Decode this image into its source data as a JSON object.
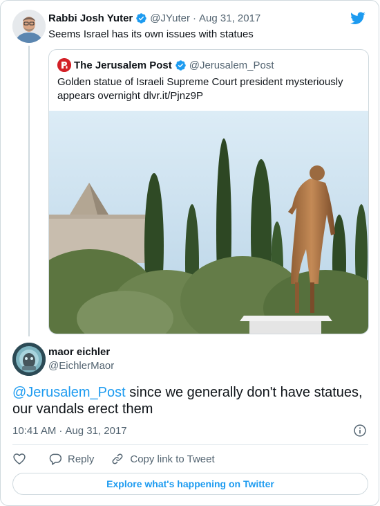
{
  "colors": {
    "accent": "#1d9bf0",
    "text": "#0f1419",
    "secondary": "#536471",
    "border": "#cfd9de",
    "jpost_brand": "#d32027"
  },
  "parent_tweet": {
    "author_name": "Rabbi Josh Yuter",
    "handle": "@JYuter",
    "separator": "·",
    "date": "Aug 31, 2017",
    "text": "Seems Israel has its own issues with statues",
    "verified": true,
    "avatar_icon": "user-avatar"
  },
  "quoted_tweet": {
    "author_name": "The Jerusalem Post",
    "handle": "@Jerusalem_Post",
    "verified": true,
    "text": "Golden statue of Israeli Supreme Court president mysteriously appears overnight dlvr.it/Pjnz9P",
    "avatar_icon": "jpost-logo",
    "image_icon": "statue-photo"
  },
  "main_tweet": {
    "author_name": "maor eichler",
    "handle": "@EichlerMaor",
    "mention": "@Jerusalem_Post",
    "text": " since we generally don't have statues, our vandals erect them",
    "time": "10:41 AM",
    "separator": "·",
    "date": "Aug 31, 2017"
  },
  "actions": {
    "like_icon": "heart-icon",
    "reply_label": "Reply",
    "reply_icon": "reply-icon",
    "copy_label": "Copy link to Tweet",
    "copy_icon": "link-icon",
    "info_icon": "info-icon"
  },
  "footer": {
    "explore_label": "Explore what's happening on Twitter"
  }
}
